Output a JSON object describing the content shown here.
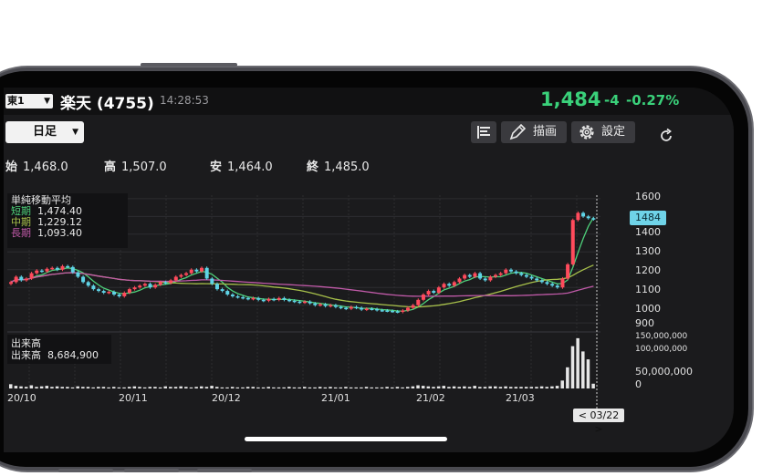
{
  "header": {
    "exchange": "東1",
    "title": "楽天 (4755)",
    "time": "14:28:53",
    "price": "1,484",
    "change": "-4",
    "change_pct": "-0.27%"
  },
  "toolbar": {
    "period": "日足",
    "draw_label": "描画",
    "settings_label": "設定"
  },
  "ohlc": {
    "open_label": "始",
    "open": "1,468.0",
    "high_label": "高",
    "high": "1,507.0",
    "low_label": "安",
    "low": "1,464.0",
    "close_label": "終",
    "close": "1,485.0"
  },
  "ma_legend": {
    "title": "単純移動平均",
    "short_label": "短期",
    "short_value": "1,474.40",
    "mid_label": "中期",
    "mid_value": "1,229.12",
    "long_label": "長期",
    "long_value": "1,093.40"
  },
  "volume_legend": {
    "title": "出来高",
    "label": "出来高",
    "value": "8,684,900"
  },
  "colors": {
    "up": "#ff4b5c",
    "down": "#5fd3e6",
    "ma_short": "#4ed07a",
    "ma_mid": "#a7c04a",
    "ma_long": "#c05aa8",
    "accent": "#3ad17a"
  },
  "chart_data": {
    "type": "candlestick",
    "price_ticks": [
      "1600",
      "1500",
      "1400",
      "1300",
      "1200",
      "1100",
      "1000",
      "900"
    ],
    "volume_ticks": [
      "150,000,000",
      "100,000,000",
      "50,000,000",
      "0"
    ],
    "x_ticks": [
      "20/10",
      "20/11",
      "20/12",
      "21/01",
      "21/02",
      "21/03"
    ],
    "ylim": [
      880,
      1620
    ],
    "volume_max": 150000000,
    "last_price_tag": "1484",
    "crosshair_date": "< 03/22 >",
    "closes": [
      1130,
      1160,
      1140,
      1150,
      1180,
      1195,
      1190,
      1205,
      1210,
      1200,
      1220,
      1215,
      1185,
      1160,
      1130,
      1110,
      1090,
      1080,
      1070,
      1075,
      1060,
      1050,
      1070,
      1090,
      1100,
      1110,
      1120,
      1100,
      1115,
      1130,
      1125,
      1140,
      1160,
      1170,
      1180,
      1200,
      1190,
      1210,
      1150,
      1120,
      1090,
      1080,
      1060,
      1050,
      1045,
      1040,
      1035,
      1040,
      1030,
      1025,
      1035,
      1030,
      1040,
      1030,
      1025,
      1020,
      1015,
      1020,
      1010,
      1000,
      1005,
      995,
      1000,
      990,
      985,
      980,
      990,
      985,
      975,
      980,
      978,
      972,
      970,
      968,
      965,
      962,
      970,
      985,
      1000,
      1030,
      1060,
      1080,
      1070,
      1100,
      1120,
      1110,
      1130,
      1150,
      1170,
      1160,
      1180,
      1150,
      1140,
      1160,
      1170,
      1180,
      1200,
      1190,
      1180,
      1170,
      1160,
      1150,
      1140,
      1130,
      1120,
      1110,
      1100,
      1150,
      1230,
      1480,
      1520,
      1500,
      1490,
      1484
    ],
    "volumes": [
      8,
      5,
      4,
      3,
      6,
      3,
      4,
      5,
      3,
      4,
      3,
      3,
      2,
      4,
      3,
      3,
      2,
      3,
      3,
      2,
      3,
      2,
      2,
      3,
      4,
      3,
      2,
      3,
      3,
      2,
      4,
      3,
      3,
      4,
      3,
      2,
      3,
      4,
      3,
      5,
      3,
      2,
      2,
      3,
      2,
      2,
      3,
      3,
      2,
      2,
      3,
      2,
      2,
      2,
      3,
      2,
      2,
      3,
      2,
      2,
      3,
      2,
      3,
      2,
      2,
      3,
      2,
      2,
      2,
      3,
      2,
      2,
      2,
      3,
      2,
      3,
      2,
      3,
      4,
      6,
      5,
      4,
      3,
      4,
      5,
      3,
      4,
      3,
      4,
      3,
      5,
      3,
      3,
      4,
      4,
      3,
      4,
      3,
      3,
      3,
      3,
      3,
      3,
      4,
      3,
      4,
      5,
      15,
      40,
      80,
      95,
      70,
      55,
      9
    ]
  }
}
